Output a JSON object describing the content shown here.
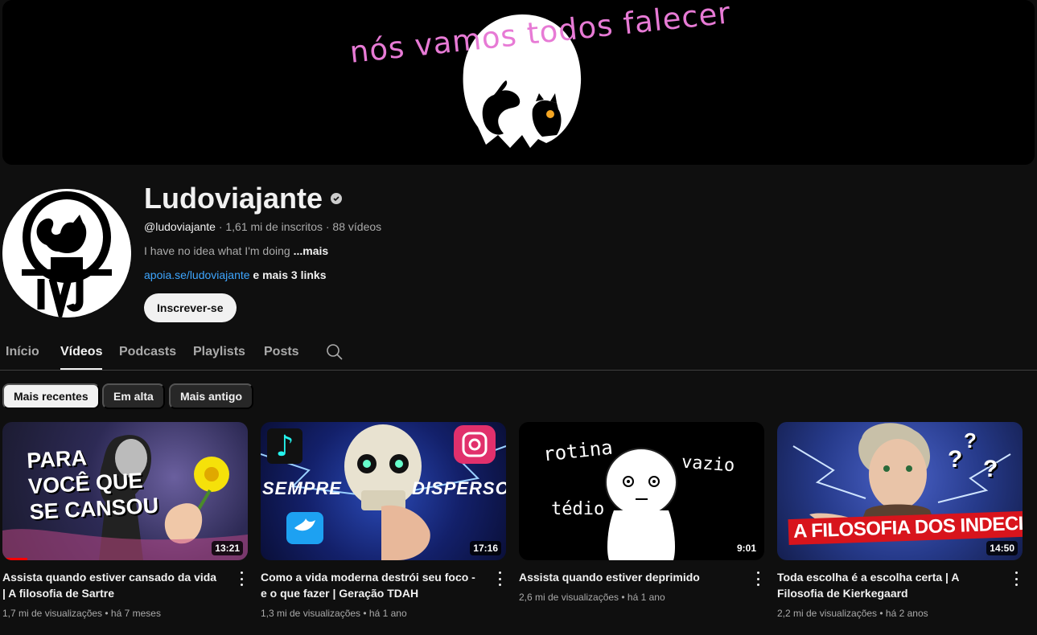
{
  "banner": {
    "text": "nós vamos todos falecer"
  },
  "channel": {
    "name": "Ludoviajante",
    "handle": "@ludoviajante",
    "stats": " · 1,61 mi de inscritos · 88 vídeos",
    "description": "I have no idea what I'm doing ",
    "description_more": "...mais",
    "link": "apoia.se/ludoviajante",
    "more_links": " e mais 3 links",
    "subscribe_label": "Inscrever-se",
    "avatar_letters": "LVJ"
  },
  "tabs": [
    {
      "label": "Início"
    },
    {
      "label": "Vídeos"
    },
    {
      "label": "Podcasts"
    },
    {
      "label": "Playlists"
    },
    {
      "label": "Posts"
    }
  ],
  "chips": [
    {
      "label": "Mais recentes"
    },
    {
      "label": "Em alta"
    },
    {
      "label": "Mais antigo"
    }
  ],
  "videos": [
    {
      "title": "Assista quando estiver cansado da vida | A filosofia de Sartre",
      "meta": "1,7 mi de visualizações • há 7 meses",
      "duration": "13:21",
      "thumb_text": [
        "PARA",
        "VOCÊ QUE",
        "SE CANSOU"
      ],
      "watched_fraction": 0.1
    },
    {
      "title": "Como a vida moderna destrói seu foco - e o que fazer | Geração TDAH",
      "meta": "1,3 mi de visualizações • há 1 ano",
      "duration": "17:16",
      "thumb_text": [
        "SEMPRE",
        "DISPERSO"
      ]
    },
    {
      "title": "Assista quando estiver deprimido",
      "meta": "2,6 mi de visualizações • há 1 ano",
      "duration": "9:01",
      "thumb_text": [
        "rotina",
        "vazio",
        "tédio"
      ]
    },
    {
      "title": "Toda escolha é a escolha certa | A Filosofia de Kierkegaard",
      "meta": "2,2 mi de visualizações • há 2 anos",
      "duration": "14:50",
      "thumb_text": [
        "A FILOSOFIA DOS INDECISOS",
        "?",
        "?",
        "?"
      ]
    }
  ],
  "colors": {
    "background": "#0f0f0f",
    "accent_link": "#3ea6ff",
    "banner_text": "#e77ad5",
    "progress": "#ff0000"
  },
  "icons": {
    "verified": "verified-check-icon",
    "search": "search-icon",
    "more": "more-vert-icon"
  }
}
